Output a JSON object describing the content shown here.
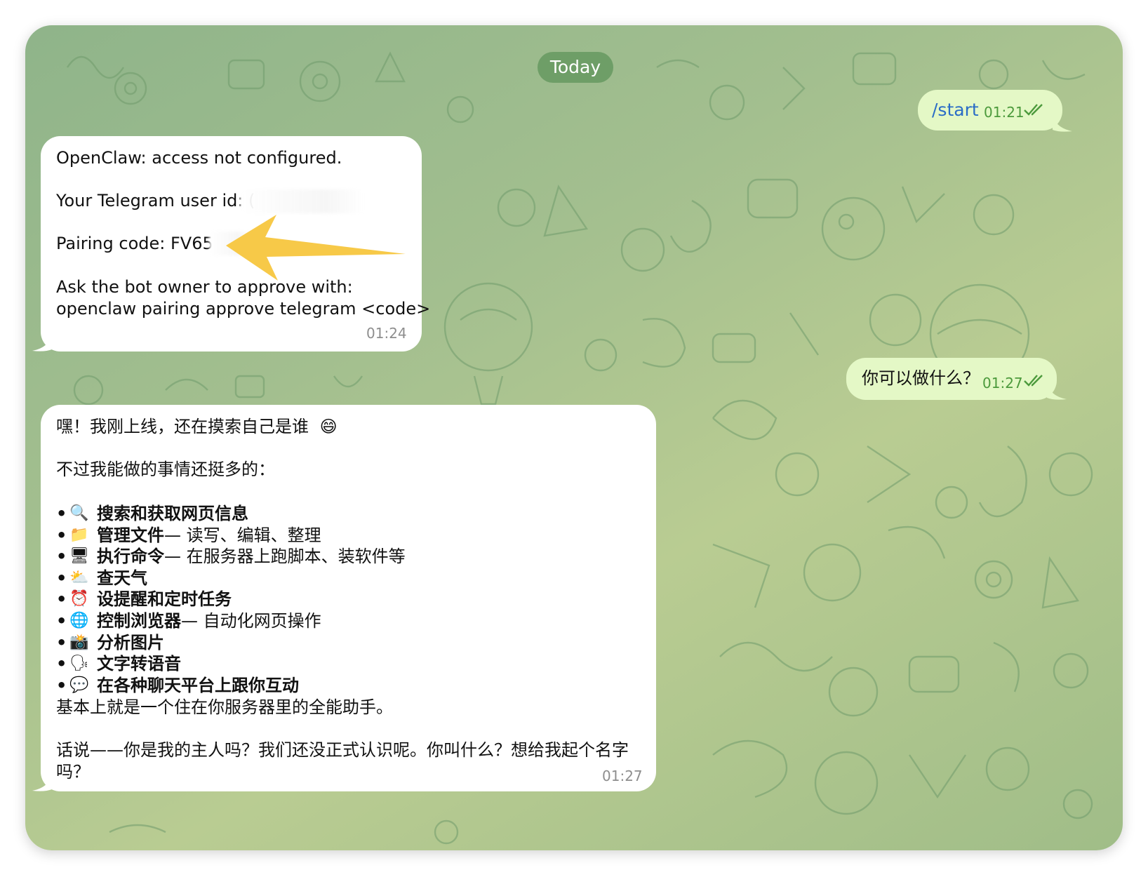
{
  "date_separator": "Today",
  "messages": [
    {
      "side": "out",
      "text": "/start",
      "time": "01:21"
    },
    {
      "side": "in",
      "lines": [
        "OpenClaw: access not configured.",
        "Your Telegram user id: (",
        "Pairing code: FV65",
        "Ask the bot owner to approve with:",
        "openclaw pairing approve telegram <code>"
      ],
      "time": "01:24"
    },
    {
      "side": "out",
      "text": "你可以做什么？",
      "time": "01:27"
    },
    {
      "side": "in",
      "intro": "嘿！我刚上线，还在摸索自己是谁",
      "intro_emoji": "😄",
      "subtitle": "不过我能做的事情还挺多的：",
      "bullet": "•",
      "items": [
        {
          "emoji": "🔍",
          "bold": "搜索和获取网页信息",
          "rest": ""
        },
        {
          "emoji": "📁",
          "bold": "管理文件",
          "rest": " — 读写、编辑、整理"
        },
        {
          "emoji": "🖥",
          "bold": "执行命令",
          "rest": " — 在服务器上跑脚本、装软件等"
        },
        {
          "emoji": "⛅",
          "bold": "查天气",
          "rest": ""
        },
        {
          "emoji": "⏰",
          "bold": "设提醒和定时任务",
          "rest": ""
        },
        {
          "emoji": "🌐",
          "bold": "控制浏览器",
          "rest": " — 自动化网页操作"
        },
        {
          "emoji": "📸",
          "bold": "分析图片",
          "rest": ""
        },
        {
          "emoji": "🗣",
          "bold": "文字转语音",
          "rest": ""
        },
        {
          "emoji": "💬",
          "bold": "在各种聊天平台上跟你互动",
          "rest": ""
        }
      ],
      "summary": "基本上就是一个住在你服务器里的全能助手。",
      "question_line1": "话说——你是我的主人吗？我们还没正式认识呢。你叫什么？想给我起个名字",
      "question_line2": "吗？",
      "time": "01:27"
    }
  ],
  "colors": {
    "incoming_bubble": "#ffffff",
    "outgoing_bubble": "#e4f8c6",
    "outgoing_time": "#4c9a3c",
    "arrow": "#f7c948",
    "date_pill": "#6e9e67"
  }
}
